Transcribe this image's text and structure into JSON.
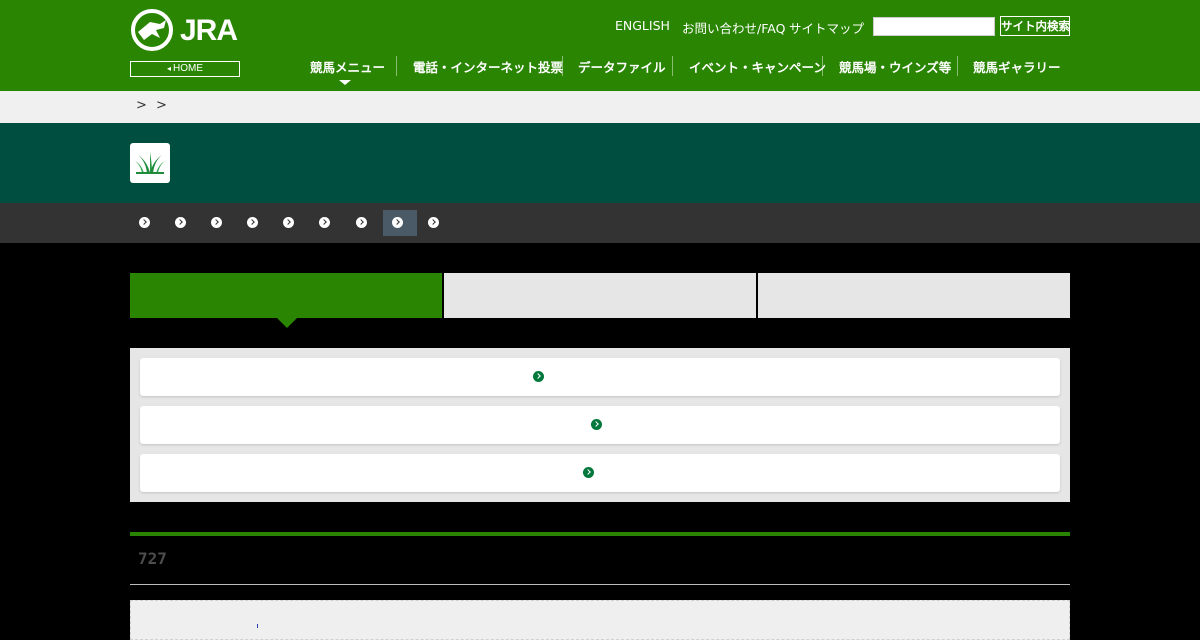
{
  "header": {
    "logo_text": "JRA",
    "home_label": "HOME",
    "util_links": [
      "ENGLISH",
      "お問い合わせ/FAQ",
      "サイトマップ"
    ],
    "search": {
      "placeholder": "",
      "button_label": "サイト内検索"
    }
  },
  "global_nav": [
    "競馬メニュー",
    "電話・インターネット投票",
    "データファイル",
    "イベント・キャンペーン",
    "競馬場・ウインズ等",
    "競馬ギャラリー"
  ],
  "breadcrumb": {
    "separator": ">"
  },
  "subnav": {
    "item_count": 9,
    "active_index": 7
  },
  "section": {
    "count": "727"
  },
  "colors": {
    "brand_green": "#2a8503",
    "title_band": "#004e3f",
    "subnav_bg": "#333333",
    "icon_green": "#00783c"
  },
  "icons": {
    "logo": "jra-horse-logo-icon",
    "turf": "turf-grass-icon",
    "link_arrow": "circle-chevron-right-icon"
  }
}
